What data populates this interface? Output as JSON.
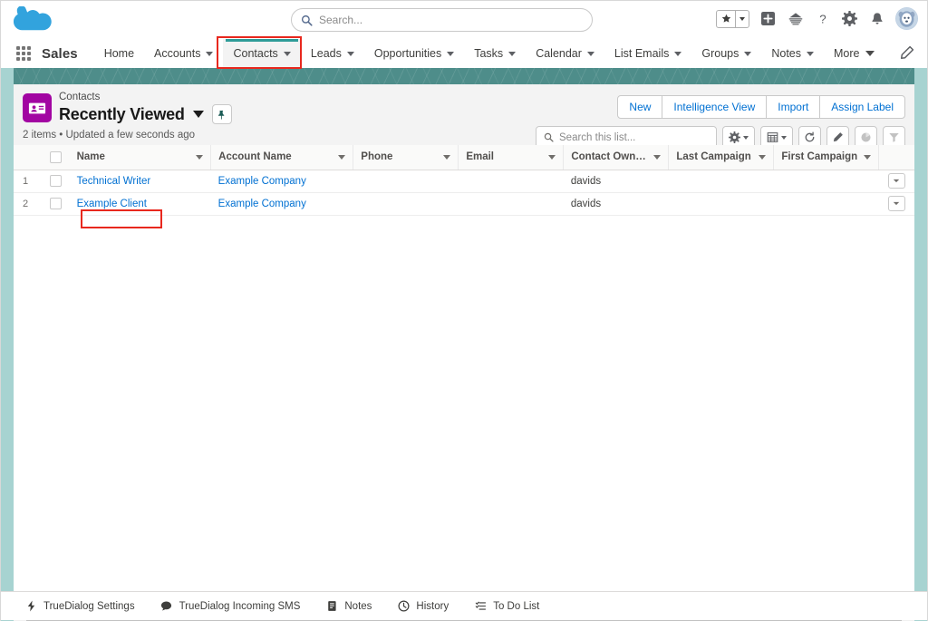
{
  "header": {
    "logo_icon": "salesforce-cloud-logo",
    "search": {
      "placeholder": "Search...",
      "icon": "search-icon"
    },
    "icons": [
      {
        "name": "favorites-star-icon",
        "glyph": "★"
      },
      {
        "name": "favorites-dropdown-icon",
        "glyph": "▾"
      },
      {
        "name": "add-icon",
        "glyph": "+"
      },
      {
        "name": "setup-cloud-icon",
        "glyph": "☁"
      },
      {
        "name": "help-icon",
        "glyph": "?"
      },
      {
        "name": "setup-gear-icon",
        "glyph": "⚙"
      },
      {
        "name": "notifications-bell-icon",
        "glyph": "🔔"
      },
      {
        "name": "user-avatar",
        "glyph": ""
      }
    ]
  },
  "nav": {
    "app_launcher_icon": "app-launcher-grid-icon",
    "app_name": "Sales",
    "items": [
      {
        "label": "Home",
        "has_caret": false,
        "active": false
      },
      {
        "label": "Accounts",
        "has_caret": true,
        "active": false
      },
      {
        "label": "Contacts",
        "has_caret": true,
        "active": true
      },
      {
        "label": "Leads",
        "has_caret": true,
        "active": false
      },
      {
        "label": "Opportunities",
        "has_caret": true,
        "active": false
      },
      {
        "label": "Tasks",
        "has_caret": true,
        "active": false
      },
      {
        "label": "Calendar",
        "has_caret": true,
        "active": false
      },
      {
        "label": "List Emails",
        "has_caret": true,
        "active": false
      },
      {
        "label": "Groups",
        "has_caret": true,
        "active": false
      },
      {
        "label": "Notes",
        "has_caret": true,
        "active": false
      },
      {
        "label": "More",
        "has_caret": true,
        "active": false
      }
    ],
    "edit_icon": "pencil-edit-icon"
  },
  "list_view": {
    "object_icon": "contacts-card-icon",
    "breadcrumb": "Contacts",
    "title": "Recently Viewed",
    "title_caret_icon": "chevron-down-icon",
    "pin_icon": "pin-icon",
    "meta": "2 items • Updated a few seconds ago",
    "buttons": [
      {
        "label": "New",
        "name": "new-button"
      },
      {
        "label": "Intelligence View",
        "name": "intelligence-view-button"
      },
      {
        "label": "Import",
        "name": "import-button"
      },
      {
        "label": "Assign Label",
        "name": "assign-label-button"
      }
    ],
    "search": {
      "placeholder": "Search this list...",
      "icon": "search-icon"
    },
    "tools": [
      {
        "name": "list-view-controls-button",
        "icon": "gear-icon",
        "caret": true,
        "disabled": false
      },
      {
        "name": "display-as-button",
        "icon": "table-icon",
        "caret": true,
        "disabled": false
      },
      {
        "name": "refresh-button",
        "icon": "refresh-icon",
        "caret": false,
        "disabled": false
      },
      {
        "name": "edit-button",
        "icon": "pencil-icon",
        "caret": false,
        "disabled": false
      },
      {
        "name": "charts-button",
        "icon": "chart-icon",
        "caret": false,
        "disabled": true
      },
      {
        "name": "filter-button",
        "icon": "filter-icon",
        "caret": false,
        "disabled": true
      }
    ],
    "columns": [
      "Name",
      "Account Name",
      "Phone",
      "Email",
      "Contact Owne...",
      "Last Campaign",
      "First Campaign"
    ],
    "rows": [
      {
        "index": "1",
        "name": "Technical Writer",
        "account_name": "Example Company",
        "phone": "",
        "email": "",
        "contact_owner": "davids",
        "last_campaign": "",
        "first_campaign": "",
        "highlighted": false
      },
      {
        "index": "2",
        "name": "Example Client",
        "account_name": "Example Company",
        "phone": "",
        "email": "",
        "contact_owner": "davids",
        "last_campaign": "",
        "first_campaign": "",
        "highlighted": true
      }
    ]
  },
  "utility_bar": [
    {
      "label": "TrueDialog Settings",
      "icon": "lightning-bolt-icon",
      "glyph": "⚡"
    },
    {
      "label": "TrueDialog Incoming SMS",
      "icon": "chat-bubble-icon",
      "glyph": "💬"
    },
    {
      "label": "Notes",
      "icon": "notes-icon",
      "glyph": "🗒"
    },
    {
      "label": "History",
      "icon": "clock-icon",
      "glyph": "🕐"
    },
    {
      "label": "To Do List",
      "icon": "todo-list-icon",
      "glyph": "☰"
    }
  ],
  "annotations": {
    "contacts_tab_highlight": "red-box-contacts-tab",
    "example_client_highlight": "red-box-example-client"
  },
  "colors": {
    "brand_teal": "#4e8d8a",
    "accent_blue": "#0070d2",
    "object_purple": "#a205a2",
    "annotation_red": "#e8281e"
  }
}
